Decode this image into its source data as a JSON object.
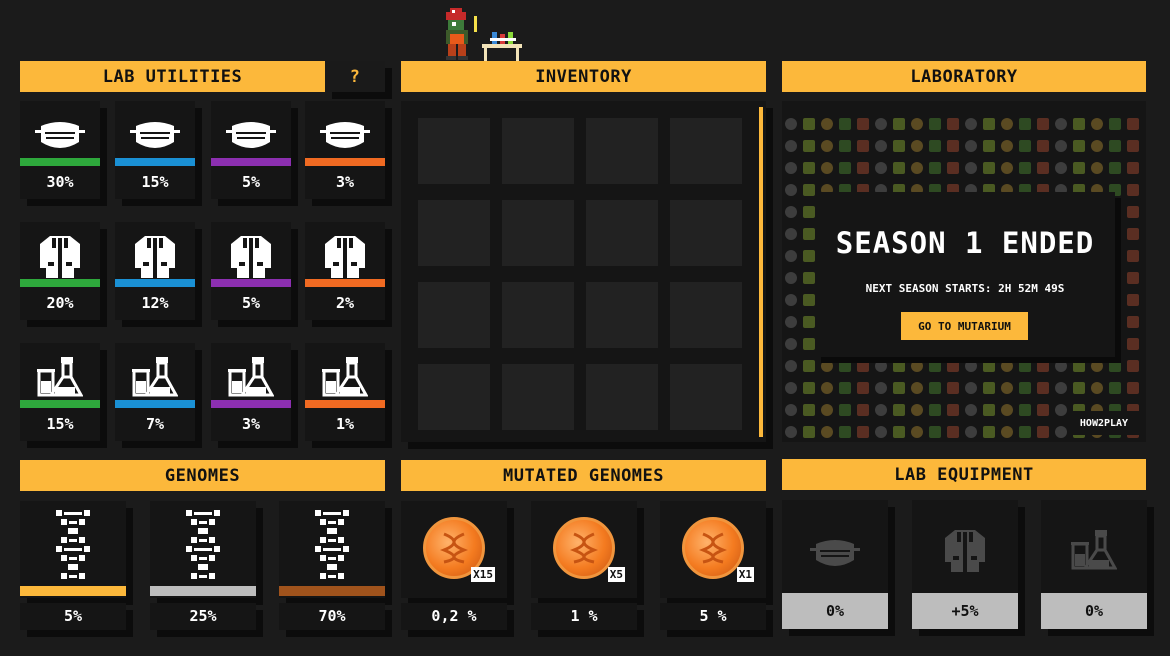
{
  "lab_utilities": {
    "title": "LAB UTILITIES",
    "help_label": "?",
    "masks": [
      "30%",
      "15%",
      "5%",
      "3%"
    ],
    "coats": [
      "20%",
      "12%",
      "5%",
      "2%"
    ],
    "flasks": [
      "15%",
      "7%",
      "3%",
      "1%"
    ],
    "rarity_colors": [
      "#2ea83c",
      "#1a90d4",
      "#8c2fb0",
      "#f06a22"
    ]
  },
  "inventory": {
    "title": "INVENTORY"
  },
  "laboratory": {
    "title": "LABORATORY",
    "season_title": "SEASON 1 ENDED",
    "next_season": "NEXT SEASON STARTS: 2H 52M 49S",
    "button_label": "GO TO MUTARIUM",
    "how2play_label": "HOW2PLAY"
  },
  "genomes": {
    "title": "GENOMES",
    "items": [
      "5%",
      "25%",
      "70%"
    ],
    "colors": [
      "#fcb83b",
      "#bdbdbd",
      "#a0531c"
    ]
  },
  "mutated_genomes": {
    "title": "MUTATED GENOMES",
    "multipliers": [
      "X15",
      "X5",
      "X1"
    ],
    "percents": [
      "0,2 %",
      "1 %",
      "5 %"
    ]
  },
  "lab_equipment": {
    "title": "LAB EQUIPMENT",
    "items": [
      "0%",
      "+5%",
      "0%"
    ]
  }
}
